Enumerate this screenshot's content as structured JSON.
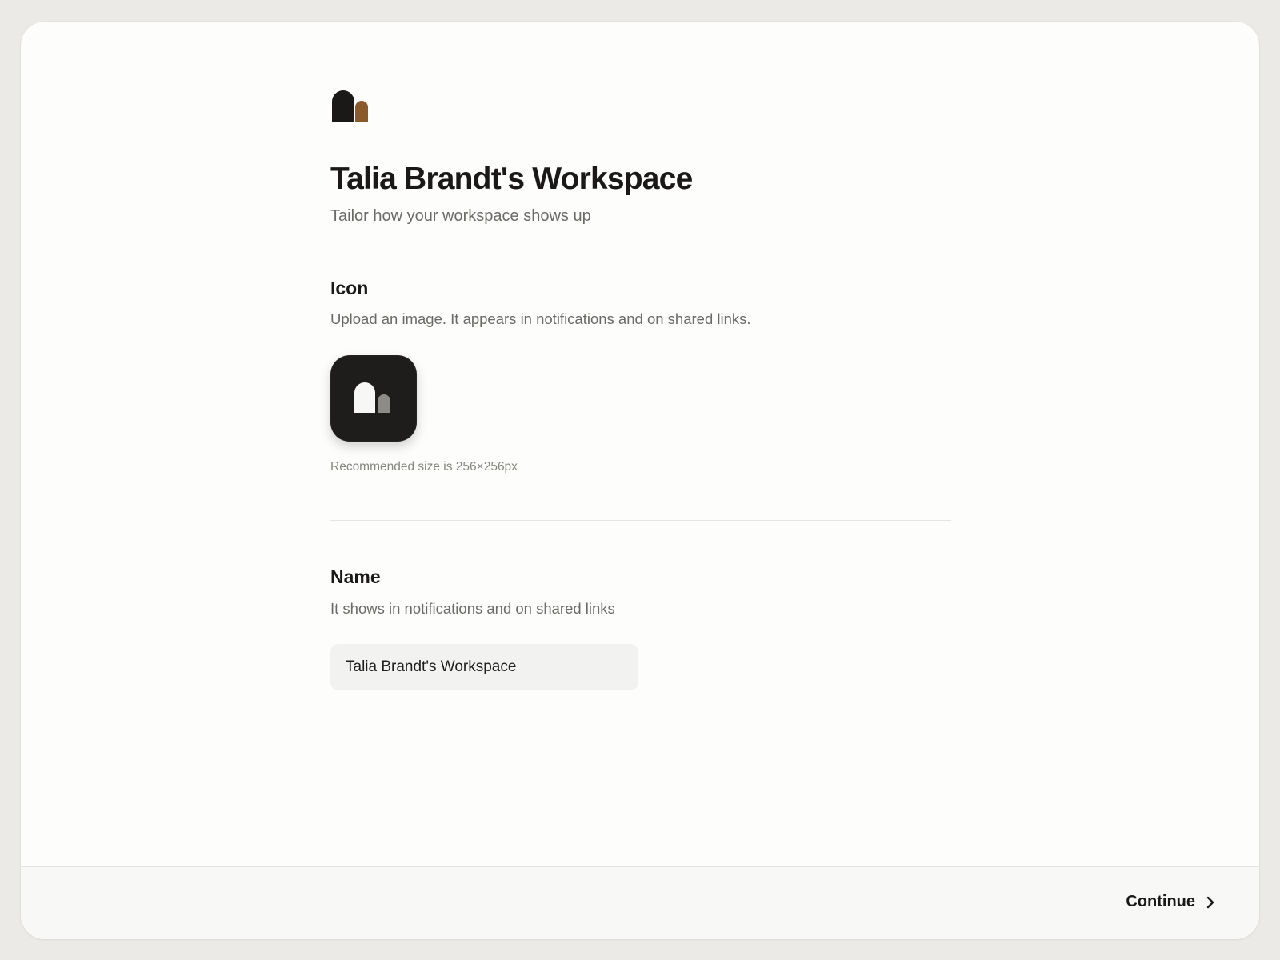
{
  "header": {
    "title": "Talia Brandt's Workspace",
    "subtitle": "Tailor how your workspace shows up",
    "logo_icon": "workspace-logo-icon"
  },
  "icon_section": {
    "heading": "Icon",
    "description": "Upload an image. It appears in notifications and on shared links.",
    "preview_icon": "workspace-app-icon",
    "hint": "Recommended size is 256×256px"
  },
  "name_section": {
    "heading": "Name",
    "description": "It shows in notifications and on shared links",
    "input_value": "Talia Brandt's Workspace"
  },
  "footer": {
    "continue_label": "Continue",
    "continue_icon": "chevron-right-icon"
  },
  "colors": {
    "page_background": "#ebeae7",
    "card_background": "#fdfdfc",
    "logo_dark": "#1a1918",
    "logo_accent": "#8b5a2b",
    "icon_tile": "#1f1d1b",
    "input_background": "#f2f2f0"
  }
}
